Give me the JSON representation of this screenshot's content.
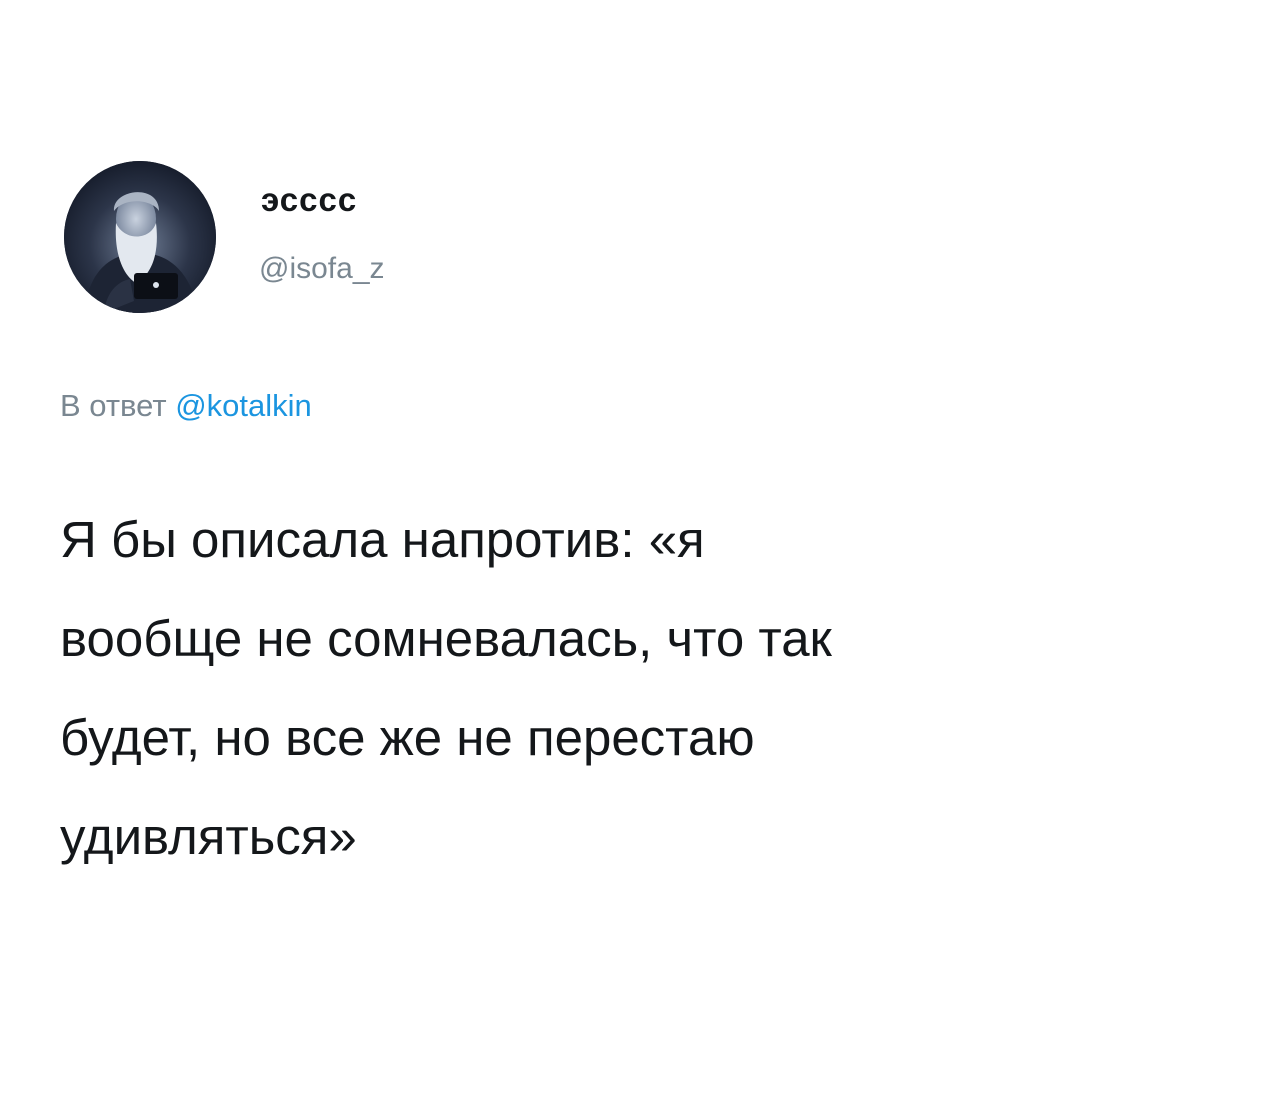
{
  "tweet": {
    "author": {
      "display_name": "эсссс",
      "handle": "@isofa_z",
      "avatar_icon": "avatar-old-bearded-man-with-laptop"
    },
    "reply": {
      "prefix": "В ответ",
      "mention": "@kotalkin"
    },
    "text_lines": [
      "Я бы описала напротив:  «я",
      "вообще не сомневалась, что так",
      "будет, но все же не перестаю",
      "удивляться»"
    ]
  },
  "colors": {
    "text": "#14171a",
    "muted": "#7a8791",
    "link": "#1b95e0",
    "background": "#ffffff"
  }
}
